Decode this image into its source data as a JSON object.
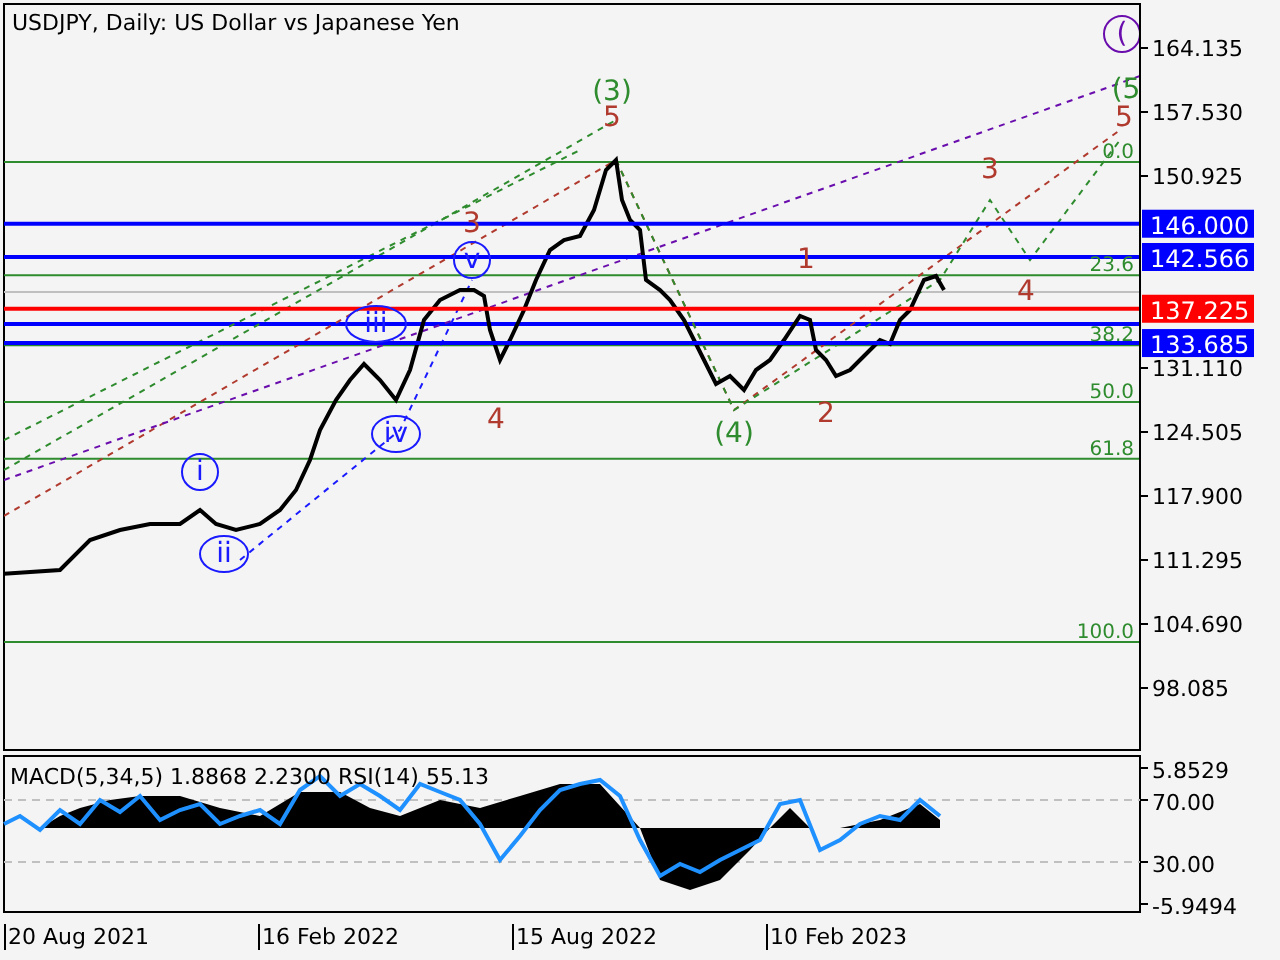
{
  "chart": {
    "title": "USDJPY, Daily:  US Dollar vs Japanese Yen",
    "price_ticks": [
      "164.135",
      "157.530",
      "150.925",
      "131.110",
      "124.505",
      "117.900",
      "111.295",
      "104.690",
      "98.085"
    ],
    "levels": [
      {
        "label": "146.000",
        "color": "#0000ff"
      },
      {
        "label": "142.566",
        "color": "#0000ff"
      },
      {
        "label": "137.225",
        "color": "#ff0000"
      },
      {
        "label": "133.685",
        "color": "#0000ff"
      }
    ],
    "fibo": [
      "0.0",
      "23.6",
      "38.2",
      "50.0",
      "61.8",
      "100.0"
    ],
    "waves": [
      {
        "text": "(3)",
        "kind": "plain",
        "color": "#2e8b2e"
      },
      {
        "text": "5",
        "kind": "plain",
        "color": "#b03a2e"
      },
      {
        "text": "3",
        "kind": "plain",
        "color": "#b03a2e"
      },
      {
        "text": "v",
        "kind": "circled",
        "color": "#1a1aff"
      },
      {
        "text": "iii",
        "kind": "circled",
        "color": "#1a1aff"
      },
      {
        "text": "iv",
        "kind": "circled",
        "color": "#1a1aff"
      },
      {
        "text": "i",
        "kind": "circled",
        "color": "#1a1aff"
      },
      {
        "text": "ii",
        "kind": "circled",
        "color": "#1a1aff"
      },
      {
        "text": "4",
        "kind": "plain",
        "color": "#b03a2e"
      },
      {
        "text": "(4)",
        "kind": "plain",
        "color": "#2e8b2e"
      },
      {
        "text": "1",
        "kind": "plain",
        "color": "#b03a2e"
      },
      {
        "text": "2",
        "kind": "plain",
        "color": "#b03a2e"
      },
      {
        "text": "3",
        "kind": "plain",
        "color": "#b03a2e"
      },
      {
        "text": "4",
        "kind": "plain",
        "color": "#b03a2e"
      },
      {
        "text": "(",
        "kind": "circled",
        "color": "#6a0dad"
      },
      {
        "text": "(5",
        "kind": "plain",
        "color": "#2e8b2e"
      },
      {
        "text": "5",
        "kind": "plain",
        "color": "#b03a2e"
      }
    ]
  },
  "indicator": {
    "label": "MACD(5,34,5) 1.8868 2.2300 RSI(14) 55.13",
    "ticks": [
      "5.8529",
      "70.00",
      "30.00",
      "-5.9494"
    ]
  },
  "dates": [
    "20 Aug 2021",
    "16 Feb 2022",
    "15 Aug 2022",
    "10 Feb 2023"
  ]
}
